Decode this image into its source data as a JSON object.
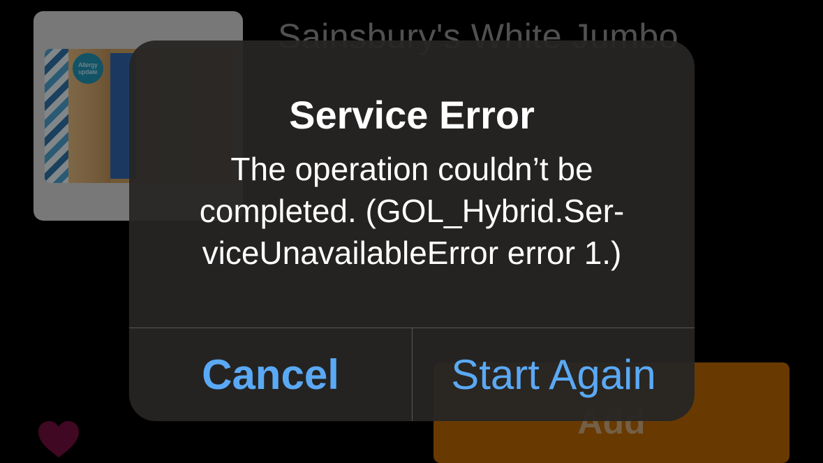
{
  "product": {
    "title": "Sainsbury's White Jumbo",
    "image_badge": "Allergy update",
    "add_button_label": "Add",
    "favourite_icon": "heart-icon",
    "colors": {
      "add_button": "#b36200",
      "favourite": "#6e0f3c"
    }
  },
  "alert": {
    "title": "Service Error",
    "message_lines": [
      "The operation couldn’t be",
      "completed. (GOL_Hybrid.Ser-",
      "viceUnavailableError error 1.)"
    ],
    "buttons": {
      "cancel": "Cancel",
      "start_again": "Start Again"
    },
    "colors": {
      "button_text": "#5aa9f5",
      "background": "#262524"
    }
  }
}
